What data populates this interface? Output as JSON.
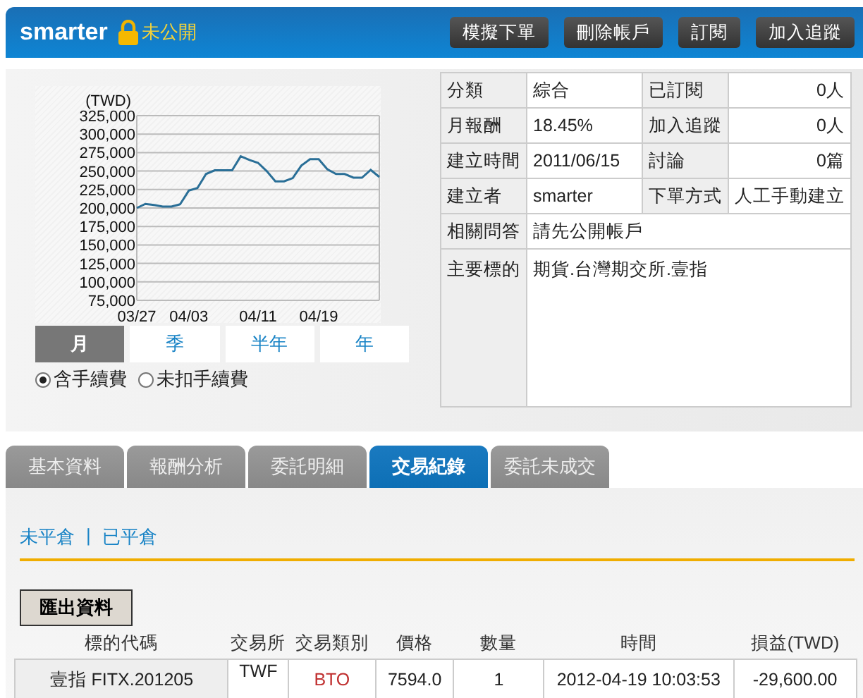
{
  "header": {
    "title": "smarter",
    "status": "未公開",
    "buttons": [
      "模擬下單",
      "刪除帳戶",
      "訂閱",
      "加入追蹤"
    ]
  },
  "chart": {
    "chart_data": {
      "type": "line",
      "ylabel": "(TWD)",
      "ylim": [
        75000,
        325000
      ],
      "grid": true,
      "categories": [
        "03/27",
        null,
        null,
        null,
        null,
        null,
        "04/03",
        null,
        null,
        null,
        null,
        null,
        null,
        null,
        "04/11",
        null,
        null,
        null,
        null,
        null,
        null,
        "04/19",
        null,
        null,
        null,
        null,
        null,
        null,
        null
      ],
      "yticks": [
        {
          "value": 75000,
          "label": "75,000"
        },
        {
          "value": 100000,
          "label": "100,000"
        },
        {
          "value": 125000,
          "label": "125,000"
        },
        {
          "value": 150000,
          "label": "150,000"
        },
        {
          "value": 175000,
          "label": "175,000"
        },
        {
          "value": 200000,
          "label": "200,000"
        },
        {
          "value": 225000,
          "label": "225,000"
        },
        {
          "value": 250000,
          "label": "250,000"
        },
        {
          "value": 275000,
          "label": "275,000"
        },
        {
          "value": 300000,
          "label": "300,000"
        },
        {
          "value": 325000,
          "label": "325,000"
        }
      ],
      "series": [
        {
          "color": "#2a6f97",
          "values": [
            200000,
            205500,
            204000,
            202000,
            202000,
            205000,
            223500,
            227000,
            246000,
            251000,
            251000,
            251000,
            270000,
            265000,
            261000,
            250000,
            236000,
            236000,
            240500,
            257500,
            266000,
            266000,
            252500,
            246000,
            246000,
            241000,
            241000,
            251500,
            242000
          ]
        }
      ]
    },
    "periods": [
      {
        "label": "月",
        "selected": true
      },
      {
        "label": "季",
        "selected": false
      },
      {
        "label": "半年",
        "selected": false
      },
      {
        "label": "年",
        "selected": false
      }
    ],
    "fee_options": [
      {
        "label": "含手續費",
        "selected": true
      },
      {
        "label": "未扣手續費",
        "selected": false
      }
    ]
  },
  "info": {
    "pairs": [
      [
        {
          "label": "分類",
          "value": "綜合"
        },
        {
          "label": "已訂閱",
          "value": "0人"
        }
      ],
      [
        {
          "label": "月報酬",
          "value": "18.45%"
        },
        {
          "label": "加入追蹤",
          "value": "0人"
        }
      ],
      [
        {
          "label": "建立時間",
          "value": "2011/06/15"
        },
        {
          "label": "討論",
          "value": "0篇"
        }
      ],
      [
        {
          "label": "建立者",
          "value": "smarter"
        },
        {
          "label": "下單方式",
          "value": "人工手動建立"
        }
      ]
    ],
    "wide": [
      {
        "label": "相關問答",
        "value": "請先公開帳戶"
      },
      {
        "label": "主要標的",
        "value": "期貨.台灣期交所.壹指"
      }
    ]
  },
  "tabs": [
    {
      "label": "基本資料",
      "selected": false
    },
    {
      "label": "報酬分析",
      "selected": false
    },
    {
      "label": "委託明細",
      "selected": false
    },
    {
      "label": "交易紀錄",
      "selected": true
    },
    {
      "label": "委託未成交",
      "selected": false
    }
  ],
  "trades": {
    "links": [
      "未平倉",
      "已平倉"
    ],
    "separator": "|",
    "export_button": "匯出資料",
    "columns": [
      "標的代碼",
      "交易所",
      "交易類別",
      "價格",
      "數量",
      "時間",
      "損益(TWD)"
    ],
    "rows": [
      [
        "壹指 FITX.201205",
        "TWF",
        "BTO",
        "7594.0",
        "1",
        "2012-04-19 10:03:53",
        "-29,600.00"
      ]
    ]
  }
}
